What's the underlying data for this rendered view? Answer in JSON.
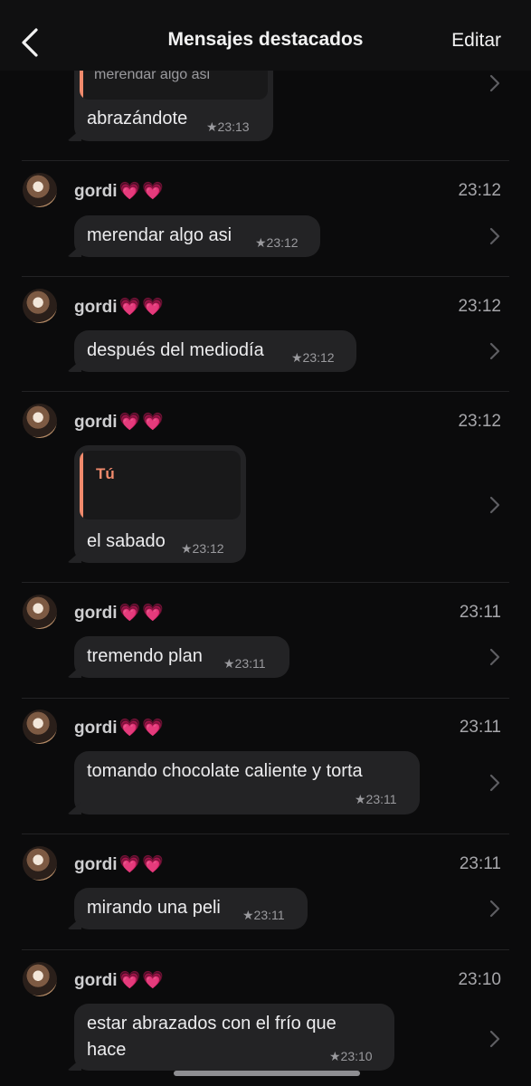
{
  "nav": {
    "back_icon": "chevron-left-icon",
    "title": "Mensajes destacados",
    "edit": "Editar"
  },
  "top_partial": {
    "quote_text": "merendar algo asi",
    "text": "abrazándote",
    "stamp": "★23:13"
  },
  "messages": [
    {
      "sender": "gordi",
      "hearts": "💗💗",
      "time": "23:12",
      "text": "merendar algo asi",
      "stamp": "★23:12"
    },
    {
      "sender": "gordi",
      "hearts": "💗💗",
      "time": "23:12",
      "text": "después del mediodía",
      "stamp": "★23:12"
    },
    {
      "sender": "gordi",
      "hearts": "💗💗",
      "time": "23:12",
      "quote_author": "Tú",
      "text": "el sabado",
      "stamp": "★23:12"
    },
    {
      "sender": "gordi",
      "hearts": "💗💗",
      "time": "23:11",
      "text": "tremendo plan",
      "stamp": "★23:11"
    },
    {
      "sender": "gordi",
      "hearts": "💗💗",
      "time": "23:11",
      "text": "tomando chocolate caliente y torta",
      "stamp": "★23:11"
    },
    {
      "sender": "gordi",
      "hearts": "💗💗",
      "time": "23:11",
      "text": "mirando una peli",
      "stamp": "★23:11"
    },
    {
      "sender": "gordi",
      "hearts": "💗💗",
      "time": "23:10",
      "text_line1": "estar abrazados con el frío que",
      "text_line2": "hace",
      "stamp": "★23:10"
    }
  ],
  "colors": {
    "background": "#0b0b0c",
    "bubble": "#232325",
    "quote_bar": "#f08a6c",
    "hearts": "#ff4fa4"
  }
}
